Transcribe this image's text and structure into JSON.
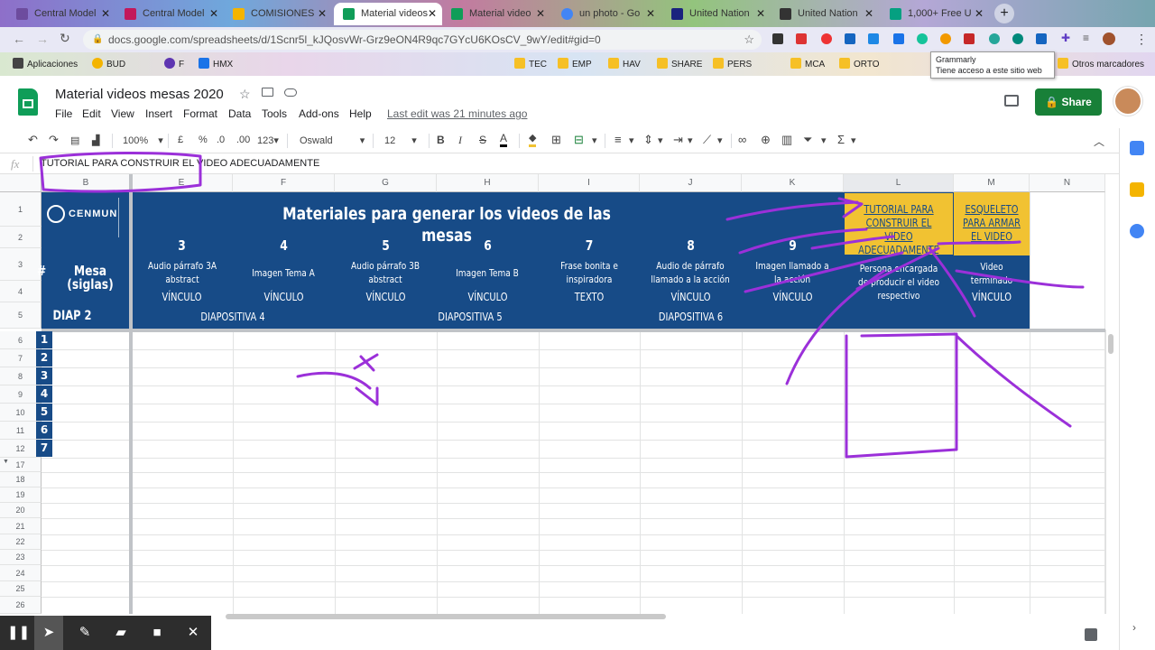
{
  "browser": {
    "tabs": [
      {
        "label": "Central Model",
        "color": "#6d4c9e"
      },
      {
        "label": "Central Model",
        "color": "#c2185b"
      },
      {
        "label": "COMISIONES",
        "color": "#f4b400"
      },
      {
        "label": "Material videos",
        "color": "#0f9d58"
      },
      {
        "label": "Material video",
        "color": "#0f9d58"
      },
      {
        "label": "un photo - Go",
        "color": "#4285f4"
      },
      {
        "label": "United Nation",
        "color": "#1a237e"
      },
      {
        "label": "United Nation",
        "color": "#333333"
      },
      {
        "label": "1,000+ Free U",
        "color": "#05a081"
      }
    ],
    "url": "docs.google.com/spreadsheets/d/1Scnr5l_kJQosvWr-Grz9eON4R9qc7GYcU6KOsCV_9wY/edit#gid=0",
    "bookmarks": [
      "Aplicaciones",
      "BUD",
      "F",
      "HMX",
      "TEC",
      "EMP",
      "HAV",
      "SHARE",
      "PERS",
      "MCA",
      "ORTO",
      "Otros marcadores"
    ],
    "tooltip": {
      "title": "Grammarly",
      "subtitle": "Tiene acceso a este sitio web"
    }
  },
  "doc": {
    "title": "Material videos mesas 2020",
    "menus": [
      "File",
      "Edit",
      "View",
      "Insert",
      "Format",
      "Data",
      "Tools",
      "Add-ons",
      "Help"
    ],
    "last_edit": "Last edit was 21 minutes ago",
    "share_label": "Share"
  },
  "toolbar": {
    "zoom": "100%",
    "currency": "£",
    "percent": "%",
    "dec_less": ".0",
    "dec_more": ".00",
    "format_more": "123",
    "font": "Oswald",
    "font_size": "12"
  },
  "formula_bar": {
    "fx": "fx",
    "content": "TUTORIAL PARA CONSTRUIR EL VIDEO ADECUADAMENTE"
  },
  "columns": [
    "B",
    "E",
    "F",
    "G",
    "H",
    "I",
    "J",
    "K",
    "L",
    "M",
    "N"
  ],
  "rows": [
    "1",
    "2",
    "3",
    "4",
    "5",
    "6",
    "7",
    "8",
    "9",
    "10",
    "11",
    "12",
    "17",
    "18",
    "19",
    "20",
    "21",
    "22",
    "23",
    "24",
    "25",
    "26"
  ],
  "sheet": {
    "logo_text": "CENMUN",
    "header_title": "Materiales para generar los videos de las mesas",
    "hash": "#",
    "mesa_label": "Mesa (siglas)",
    "diap2": "DIAP 2",
    "items": [
      {
        "num": "3",
        "desc": "Audio párrafo 3A abstract",
        "type": "VÍNCULO"
      },
      {
        "num": "4",
        "desc": "Imagen Tema A",
        "type": "VÍNCULO"
      },
      {
        "num": "5",
        "desc": "Audio párrafo 3B abstract",
        "type": "VÍNCULO"
      },
      {
        "num": "6",
        "desc": "Imagen Tema B",
        "type": "VÍNCULO"
      },
      {
        "num": "7",
        "desc": "Frase bonita e inspiradora",
        "type": "TEXTO"
      },
      {
        "num": "8",
        "desc": "Audio de párrafo llamado a la acción",
        "type": "VÍNCULO"
      },
      {
        "num": "9",
        "desc": "Imagen llamado a la acción",
        "type": "VÍNCULO"
      }
    ],
    "diapositivas": [
      "DIAPOSITIVA 4",
      "DIAPOSITIVA 5",
      "DIAPOSITIVA 6"
    ],
    "tutorial_link": "TUTORIAL PARA CONSTRUIR EL VIDEO ADECUADAMENTE",
    "esqueleto_link": "ESQUELETO PARA ARMAR EL VIDEO",
    "persona_label": "Persona encargada de producir el video respectivo",
    "video_label": "Video terminado",
    "video_type": "VÍNCULO",
    "mesa_numbers": [
      "1",
      "2",
      "3",
      "4",
      "5",
      "6",
      "7"
    ]
  },
  "colors": {
    "header_blue": "#174b87",
    "gold": "#f1c232",
    "annotation": "#9b30d9",
    "share_green": "#188038"
  }
}
